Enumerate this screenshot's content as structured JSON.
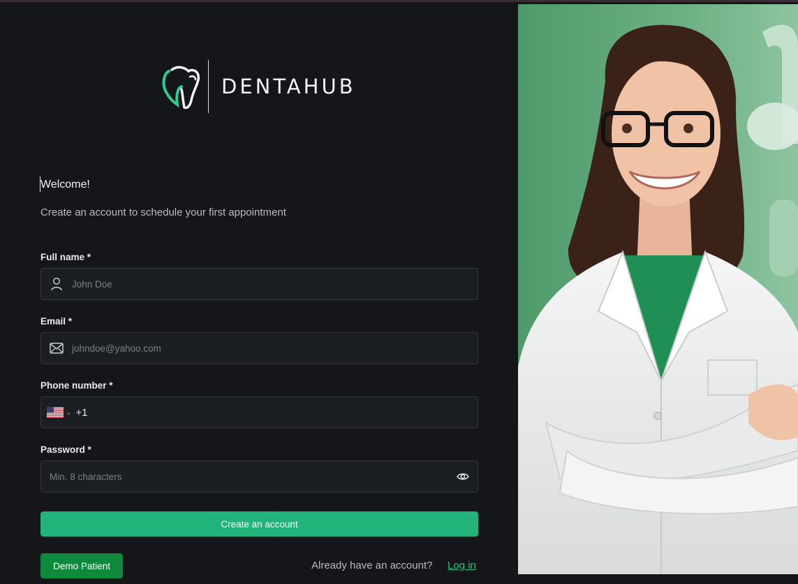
{
  "brand": {
    "name": "DENTAHUB",
    "accent": "#2ecc8f"
  },
  "form": {
    "welcome": "Welcome!",
    "subtitle": "Create an account to schedule your first appointment",
    "full_name": {
      "label": "Full name *",
      "placeholder": "John Doe",
      "icon": "user-icon"
    },
    "email": {
      "label": "Email *",
      "placeholder": "johndoe@yahoo.com",
      "icon": "mail-icon"
    },
    "phone": {
      "label": "Phone number *",
      "country": "US",
      "dial_code": "+1",
      "icon": "us-flag-icon"
    },
    "password": {
      "label": "Password *",
      "placeholder": "Min. 8 characters",
      "icon": "eye-icon"
    },
    "submit_label": "Create an account"
  },
  "footer": {
    "demo_label": "Demo Patient",
    "have_account": "Already have an account?",
    "login_label": "Log in"
  },
  "colors": {
    "primary_button": "#22b47b",
    "demo_button": "#0f8a3d",
    "link": "#25c07f",
    "background": "#141619",
    "photo_bg": "#5fa678"
  }
}
